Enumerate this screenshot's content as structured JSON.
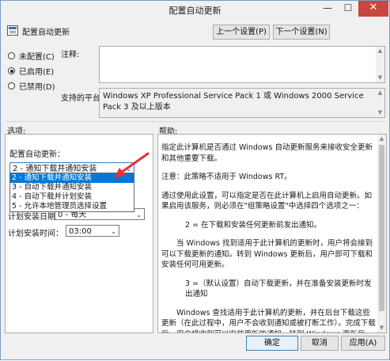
{
  "window": {
    "title": "配置自动更新",
    "minimize_glyph": "—",
    "maximize_glyph": "☐",
    "close_glyph": "✕"
  },
  "header": {
    "policy_title": "配置自动更新",
    "prev_button": "上一个设置(P)",
    "next_button": "下一个设置(N)"
  },
  "state": {
    "options": [
      "未配置(C)",
      "已启用(E)",
      "已禁用(D)"
    ],
    "selected": "已启用(E)"
  },
  "comment": {
    "label": "注释:",
    "value": ""
  },
  "platform": {
    "label": "支持的平台:",
    "value": "Windows XP Professional Service Pack 1 或 Windows 2000 Service Pack 3 及以上版本"
  },
  "sections": {
    "options_label": "选项:",
    "help_label": "帮助:"
  },
  "options": {
    "configure_label": "配置自动更新：",
    "configure_value": "2 - 通知下载并通知安装",
    "dropdown_items": [
      "2 - 通知下载并通知安装",
      "3 - 自动下载并通知安装",
      "4 - 自动下载并计划安装",
      "5 - 允许本地管理员选择设置"
    ],
    "day_label": "计划安装日期：",
    "day_value": "0 - 每天",
    "time_label": "计划安装时间：",
    "time_value": "03:00"
  },
  "help": {
    "paragraphs": [
      "指定此计算机是否通过 Windows 自动更新服务来接收安全更新和其他重要下载。",
      "注意：此策略不适用于 Windows RT。",
      "通过使用此设置，可以指定是否在此计算机上启用自动更新。如果启用该服务，则必须在\"组策略设置\"中选择四个选项之一：",
      "2 = 在下载和安装任何更新前发出通知。",
      "当 Windows 找到适用于此计算机的更新时，用户将会接到可以下载更新的通知。转到 Windows 更新后，用户即可下载和安装任何可用更新。",
      "3 =（默认设置）自动下载更新，并在准备安装更新时发出通知",
      "Windows 查找适用于此计算机的更新，并在后台下载这些更新（在此过程中，用户不会收到通知或被打断工作）。完成下载后，用户将收到可以安装更新的通知。转到 Windows 更新后，用户即可安装更新。"
    ]
  },
  "footer": {
    "ok": "确定",
    "cancel": "取消",
    "apply": "应用(A)"
  },
  "colors": {
    "close_button": "#c7463d",
    "selection": "#0078d7",
    "annotation_arrow": "#e8303a"
  }
}
